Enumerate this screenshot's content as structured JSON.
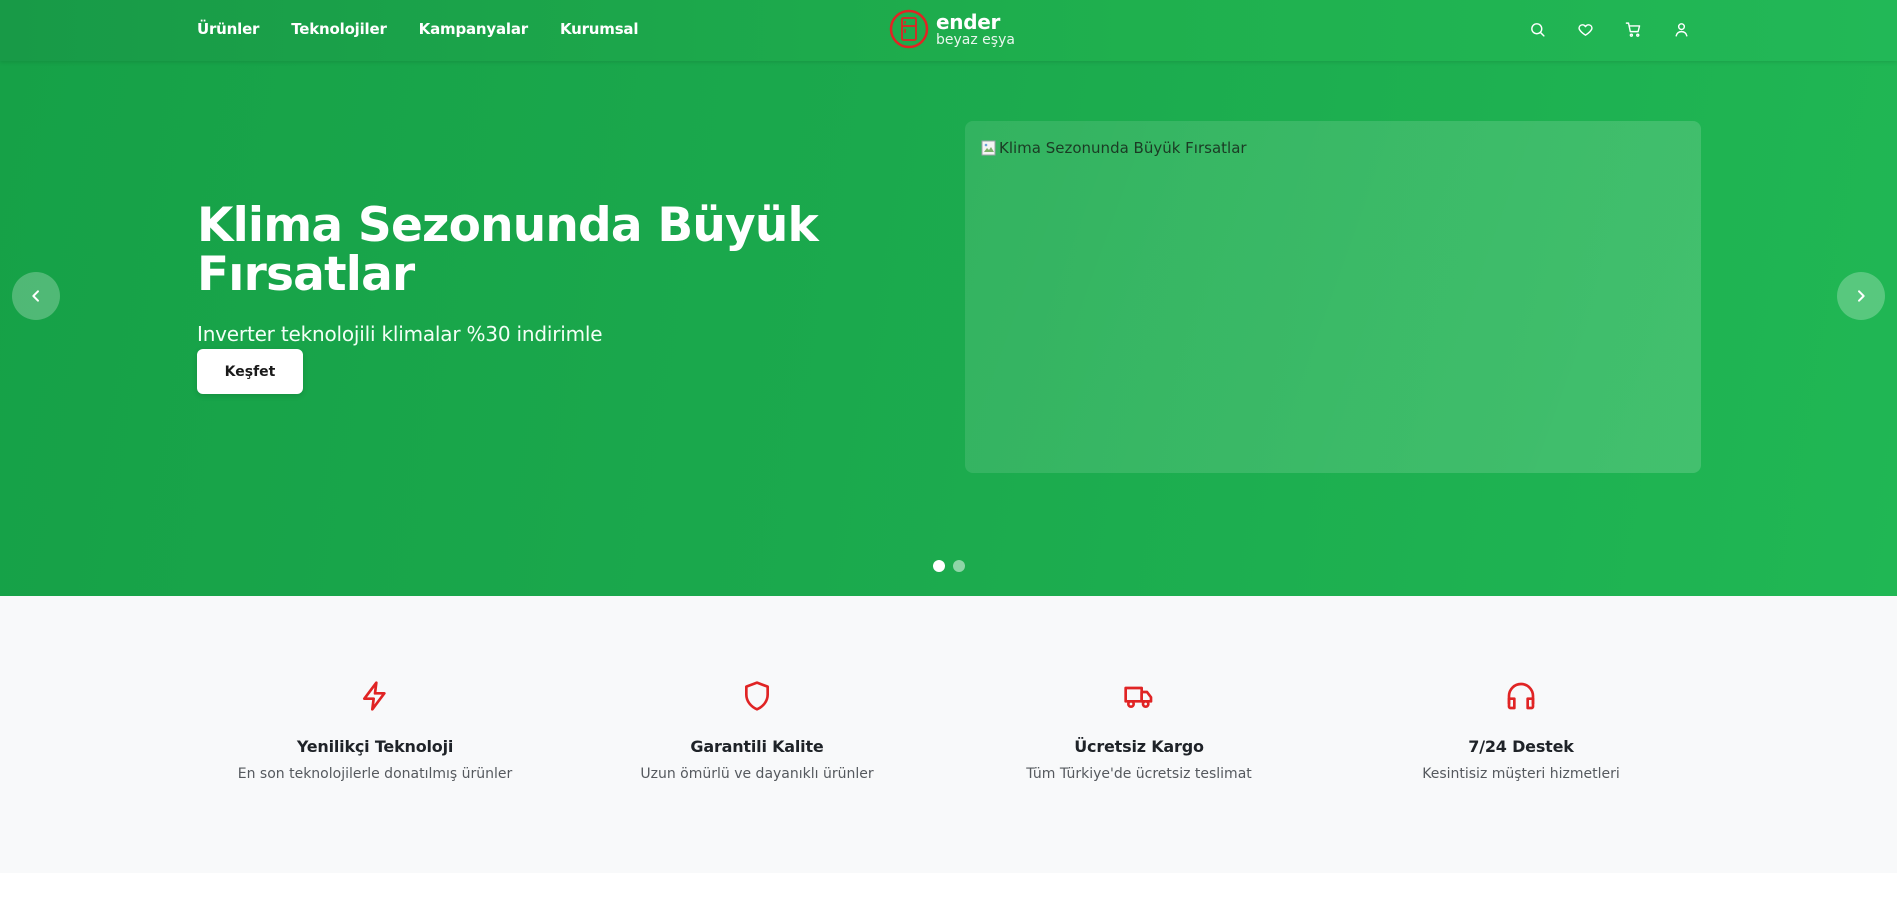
{
  "nav": {
    "items": [
      {
        "label": "Ürünler"
      },
      {
        "label": "Teknolojiler"
      },
      {
        "label": "Kampanyalar"
      },
      {
        "label": "Kurumsal"
      }
    ]
  },
  "logo": {
    "name": "ender",
    "subtitle": "beyaz eşya",
    "icon": "refrigerator-icon"
  },
  "header_actions": [
    "search-icon",
    "heart-icon",
    "cart-icon",
    "user-icon"
  ],
  "hero": {
    "title": "Klima Sezonunda Büyük Fırsatlar",
    "subtitle": "Inverter teknolojili klimalar %30 indirimle",
    "cta_label": "Keşfet",
    "image_alt": "Klima Sezonunda Büyük Fırsatlar",
    "slide_count": 2,
    "active_slide": 1
  },
  "features": [
    {
      "icon": "lightning-icon",
      "title": "Yenilikçi Teknoloji",
      "description": "En son teknolojilerle donatılmış ürünler"
    },
    {
      "icon": "shield-icon",
      "title": "Garantili Kalite",
      "description": "Uzun ömürlü ve dayanıklı ürünler"
    },
    {
      "icon": "truck-icon",
      "title": "Ücretsiz Kargo",
      "description": "Tüm Türkiye'de ücretsiz teslimat"
    },
    {
      "icon": "headphones-icon",
      "title": "7/24 Destek",
      "description": "Kesintisiz müşteri hizmetleri"
    }
  ],
  "colors": {
    "brand_green": "#1ba94d",
    "accent_red": "#e02424",
    "white": "#ffffff"
  }
}
